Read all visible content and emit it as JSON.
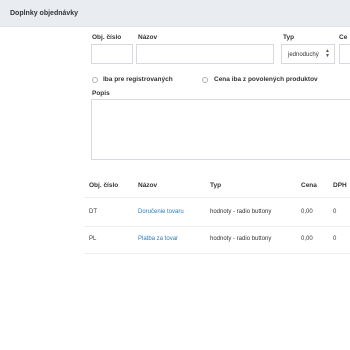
{
  "panel": {
    "title": "Doplnky objednávky"
  },
  "form": {
    "obj_cislo_label": "Obj. číslo",
    "nazov_label": "Názov",
    "typ_label": "Typ",
    "ce_label": "Ce",
    "typ_select_value": "jednoduchý",
    "checkbox_registered_label": "Iba pre registrovaných",
    "checkbox_price_label": "Cena iba z povolených produktov",
    "popis_label": "Popis"
  },
  "table": {
    "headers": [
      "Obj. číslo",
      "Názov",
      "Typ",
      "Cena",
      "DPH"
    ],
    "rows": [
      {
        "obj_cislo": "DT",
        "nazov": "Doručenie tovaru",
        "typ": "hodnoty - radio buttony",
        "cena": "0,00",
        "dph": "0"
      },
      {
        "obj_cislo": "PL",
        "nazov": "Platba za tovar",
        "typ": "hodnoty - radio buttony",
        "cena": "0,00",
        "dph": "0"
      }
    ]
  }
}
